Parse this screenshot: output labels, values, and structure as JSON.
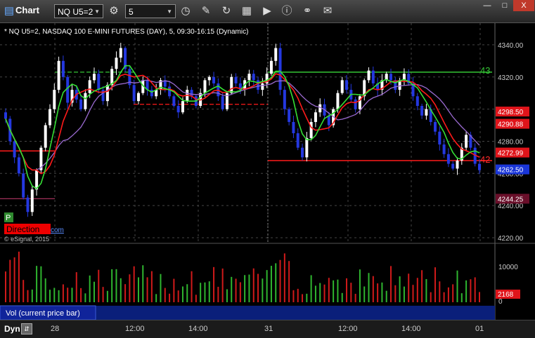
{
  "window": {
    "title": "Chart",
    "symbol": "NQ U5=2",
    "interval": "5",
    "close_label": "X",
    "minimize_label": "—",
    "maximize_label": "□"
  },
  "chart": {
    "title": "* NQ U5=2, NASDAQ 100 E-MINI FUTURES (DAY), 5, 09:30-16:15 (Dynamic)",
    "copyright": "© eSignal, 2015",
    "direction_badge": "Direction",
    "direction_link": "com",
    "p_badge": "P",
    "line_labels": {
      "green": "43",
      "red": "42"
    },
    "price_ticks": [
      "4340.00",
      "4320.00",
      "4300.00",
      "4280.00",
      "4260.00",
      "4240.00",
      "4220.00"
    ],
    "price_tags": [
      {
        "label": "4298.50",
        "color": "#e0141a"
      },
      {
        "label": "4290.88",
        "color": "#e0141a"
      },
      {
        "label": "4272.99",
        "color": "#e0141a"
      },
      {
        "label": "4262.50",
        "color": "#1a36d8"
      },
      {
        "label": "4244.25",
        "color": "#6a0f2a"
      }
    ],
    "volume": {
      "label": "Vol (current price bar)",
      "ticks": [
        "10000",
        "0"
      ],
      "tag": "2168"
    },
    "time_ticks": [
      "28",
      "12:00",
      "14:00",
      "31",
      "12:00",
      "14:00",
      "01"
    ],
    "status": {
      "dyn_label": "Dyn"
    },
    "colors": {
      "up": "#ffffff",
      "down": "#2438e0",
      "sma_red": "#ff1a1a",
      "sma_green": "#35e035",
      "sma_purple": "#9a6ad0"
    }
  },
  "chart_data": {
    "type": "candlestick",
    "title": "* NQ U5=2, NASDAQ 100 E-MINI FUTURES (DAY), 5, 09:30-16:15 (Dynamic)",
    "ylim": [
      4220,
      4350
    ],
    "yticks": [
      4220,
      4240,
      4260,
      4280,
      4300,
      4320,
      4340
    ],
    "levels": [
      {
        "value": 4323,
        "label": "43",
        "color": "#35c535"
      },
      {
        "value": 4268,
        "label": "42",
        "color": "#ff1a1a"
      },
      {
        "value": 4298.5,
        "color": "#ff1a1a"
      },
      {
        "value": 4290.88,
        "color": "#ff1a1a"
      },
      {
        "value": 4272.99,
        "color": "#ff1a1a"
      },
      {
        "value": 4262.5,
        "color": "#1a36d8"
      },
      {
        "value": 4244.25,
        "color": "#6a0f2a"
      }
    ],
    "closes": [
      4294,
      4280,
      4270,
      4260,
      4245,
      4236,
      4250,
      4262,
      4276,
      4290,
      4300,
      4312,
      4330,
      4320,
      4304,
      4312,
      4306,
      4300,
      4310,
      4318,
      4322,
      4312,
      4305,
      4315,
      4325,
      4332,
      4338,
      4325,
      4315,
      4305,
      4310,
      4318,
      4312,
      4308,
      4312,
      4318,
      4314,
      4308,
      4302,
      4298,
      4305,
      4312,
      4308,
      4302,
      4310,
      4318,
      4320,
      4316,
      4308,
      4300,
      4310,
      4320,
      4316,
      4312,
      4318,
      4322,
      4318,
      4312,
      4316,
      4322,
      4330,
      4338,
      4312,
      4300,
      4292,
      4285,
      4276,
      4270,
      4282,
      4292,
      4298,
      4303,
      4296,
      4290,
      4300,
      4310,
      4318,
      4312,
      4306,
      4300,
      4308,
      4318,
      4324,
      4316,
      4312,
      4318,
      4322,
      4318,
      4312,
      4318,
      4322,
      4316,
      4308,
      4302,
      4296,
      4300,
      4292,
      4286,
      4278,
      4272,
      4266,
      4263,
      4268,
      4276,
      4284,
      4276,
      4266,
      4262
    ],
    "volume_max": 12000
  }
}
